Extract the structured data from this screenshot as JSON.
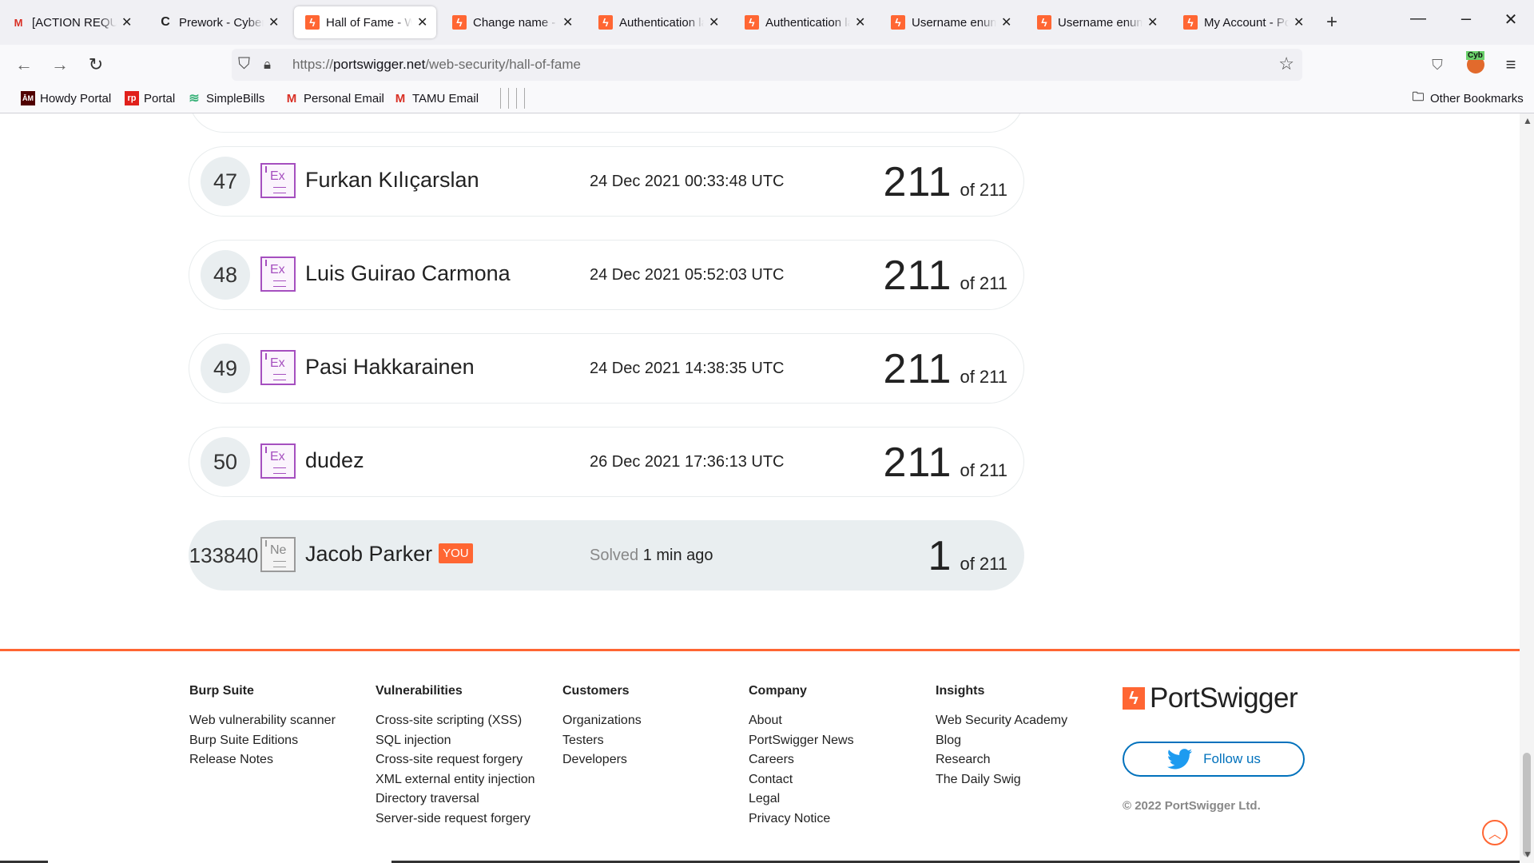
{
  "browser": {
    "tabs": [
      {
        "title": "[ACTION REQUIRED]",
        "icon": "gmail-icon"
      },
      {
        "title": "Prework - Cybersecurity",
        "icon": "codepath-icon"
      },
      {
        "title": "Hall of Fame - Web Security Academy",
        "icon": "portswigger-icon",
        "active": true
      },
      {
        "title": "Change name - PortSwigger",
        "icon": "portswigger-icon"
      },
      {
        "title": "Authentication lab",
        "icon": "portswigger-icon"
      },
      {
        "title": "Authentication lab",
        "icon": "portswigger-icon"
      },
      {
        "title": "Username enumeration",
        "icon": "portswigger-icon"
      },
      {
        "title": "Username enumeration",
        "icon": "portswigger-icon"
      },
      {
        "title": "My Account - PortSwigger",
        "icon": "portswigger-icon"
      }
    ],
    "url": {
      "scheme": "https://",
      "host": "portswigger.net",
      "path": "/web-security/hall-of-fame"
    },
    "extension_label": "Cyb",
    "bookmarks": [
      {
        "label": "Howdy Portal",
        "icon": "tamu-icon"
      },
      {
        "label": "Portal",
        "icon": "portal-icon"
      },
      {
        "label": "SimpleBills",
        "icon": "simplebills-icon"
      },
      {
        "label": "Personal Email",
        "icon": "gmail-icon"
      },
      {
        "label": "TAMU Email",
        "icon": "gmail-icon"
      }
    ],
    "other_bookmarks": "Other Bookmarks"
  },
  "leaderboard": {
    "rows": [
      {
        "rank": "47",
        "badge": "Ex",
        "name": "Furkan Kılıçarslan",
        "date": "24 Dec 2021 00:33:48 UTC",
        "solved": "211",
        "of": "of 211"
      },
      {
        "rank": "48",
        "badge": "Ex",
        "name": "Luis Guirao Carmona",
        "date": "24 Dec 2021 05:52:03 UTC",
        "solved": "211",
        "of": "of 211"
      },
      {
        "rank": "49",
        "badge": "Ex",
        "name": "Pasi Hakkarainen",
        "date": "24 Dec 2021 14:38:35 UTC",
        "solved": "211",
        "of": "of 211"
      },
      {
        "rank": "50",
        "badge": "Ex",
        "name": "dudez",
        "date": "26 Dec 2021 17:36:13 UTC",
        "solved": "211",
        "of": "of 211"
      }
    ],
    "me": {
      "rank": "133840",
      "badge": "Ne",
      "name": "Jacob Parker",
      "you_label": "YOU",
      "solved_label": "Solved",
      "solved_when": "1 min ago",
      "solved": "1",
      "of": "of 211"
    }
  },
  "footer": {
    "columns": [
      {
        "heading": "Burp Suite",
        "links": [
          "Web vulnerability scanner",
          "Burp Suite Editions",
          "Release Notes"
        ]
      },
      {
        "heading": "Vulnerabilities",
        "links": [
          "Cross-site scripting (XSS)",
          "SQL injection",
          "Cross-site request forgery",
          "XML external entity injection",
          "Directory traversal",
          "Server-side request forgery"
        ]
      },
      {
        "heading": "Customers",
        "links": [
          "Organizations",
          "Testers",
          "Developers"
        ]
      },
      {
        "heading": "Company",
        "links": [
          "About",
          "PortSwigger News",
          "Careers",
          "Contact",
          "Legal",
          "Privacy Notice"
        ]
      },
      {
        "heading": "Insights",
        "links": [
          "Web Security Academy",
          "Blog",
          "Research",
          "The Daily Swig"
        ]
      }
    ],
    "brand": "PortSwigger",
    "follow_label": "Follow us",
    "copyright": "© 2022 PortSwigger Ltd."
  },
  "colors": {
    "accent": "#ff6633",
    "twitter": "#0071bc",
    "expert_badge": "#a54fbf"
  }
}
